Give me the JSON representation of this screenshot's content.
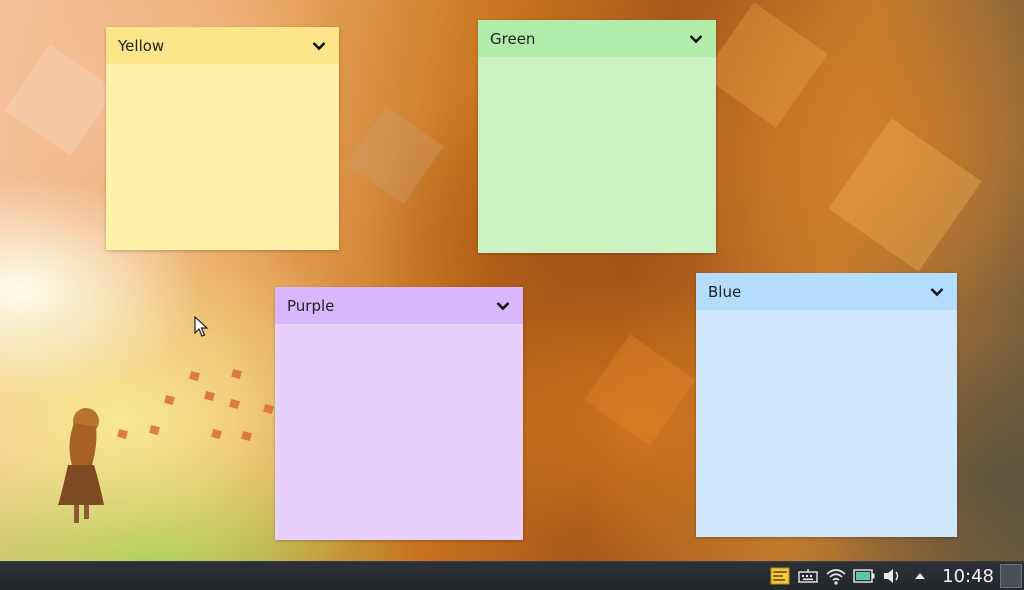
{
  "notes": [
    {
      "id": "yellow",
      "title": "Yellow",
      "header_color": "#fde68a",
      "body_color": "#fff2a8"
    },
    {
      "id": "green",
      "title": "Green",
      "header_color": "#b2ecaa",
      "body_color": "#ccf2c4"
    },
    {
      "id": "purple",
      "title": "Purple",
      "header_color": "#d9b7fc",
      "body_color": "#e8d0fd"
    },
    {
      "id": "blue",
      "title": "Blue",
      "header_color": "#b4dcfc",
      "body_color": "#cfe7fd"
    }
  ],
  "icons": {
    "note_menu": "chevron-down-icon",
    "tray": [
      "sticky-notes-icon",
      "keyboard-icon",
      "wifi-icon",
      "battery-icon",
      "volume-icon",
      "expand-tray-icon"
    ]
  },
  "taskbar": {
    "clock": "10:48"
  },
  "colors": {
    "taskbar_bg": "#2a2e33",
    "clock_text": "#eef0f2"
  }
}
